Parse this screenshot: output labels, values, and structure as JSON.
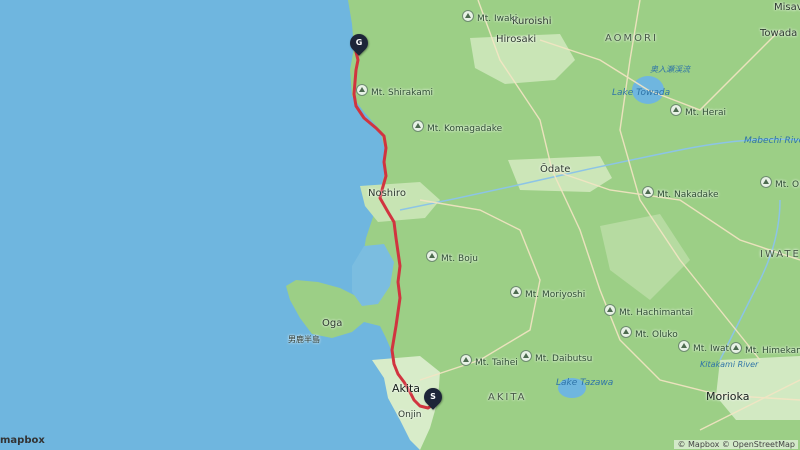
{
  "map": {
    "cities": [
      {
        "id": "misawa",
        "name": "Misav"
      },
      {
        "id": "kuroishi",
        "name": "Kuroishi"
      },
      {
        "id": "hirosaki",
        "name": "Hirosaki"
      },
      {
        "id": "towada",
        "name": "Towada"
      },
      {
        "id": "noshiro",
        "name": "Noshiro"
      },
      {
        "id": "odate",
        "name": "Ōdate"
      },
      {
        "id": "oga",
        "name": "Oga"
      },
      {
        "id": "akita",
        "name": "Akita"
      },
      {
        "id": "morioka",
        "name": "Morioka"
      }
    ],
    "cities_partial": [
      {
        "id": "oga-kanji",
        "name": "男鹿半島"
      },
      {
        "id": "akita-south",
        "name": "Onjin"
      }
    ],
    "regions": [
      {
        "id": "aomori",
        "name": "AOMORI"
      },
      {
        "id": "iwate",
        "name": "IWATE"
      },
      {
        "id": "akita-pref",
        "name": "AKITA"
      }
    ],
    "mountains": [
      {
        "id": "iwaki",
        "name": "Mt. Iwaki"
      },
      {
        "id": "shirakami",
        "name": "Mt. Shirakami"
      },
      {
        "id": "komagadake",
        "name": "Mt. Komagadake"
      },
      {
        "id": "herai",
        "name": "Mt. Herai"
      },
      {
        "id": "nakadake",
        "name": "Mt. Nakadake"
      },
      {
        "id": "orifu",
        "name": "Mt. Orifu"
      },
      {
        "id": "boju",
        "name": "Mt. Boju"
      },
      {
        "id": "moriyoshi",
        "name": "Mt. Moriyoshi"
      },
      {
        "id": "hachimantai",
        "name": "Mt. Hachimantai"
      },
      {
        "id": "oluko",
        "name": "Mt. Oluko"
      },
      {
        "id": "iwate",
        "name": "Mt. Iwate"
      },
      {
        "id": "himekami",
        "name": "Mt. Himekami"
      },
      {
        "id": "taihei",
        "name": "Mt. Taihei"
      },
      {
        "id": "daibutsu",
        "name": "Mt. Daibutsu"
      }
    ],
    "water": [
      {
        "id": "towada-lake",
        "name": "Lake Towada"
      },
      {
        "id": "towada-kanji",
        "name": "奥入瀬渓流"
      },
      {
        "id": "mabechi",
        "name": "Mabechi River"
      },
      {
        "id": "tazawa",
        "name": "Lake Tazawa"
      },
      {
        "id": "kitakami",
        "name": "Kitakami River"
      }
    ],
    "markers": {
      "start_label": "S",
      "goal_label": "G"
    },
    "attribution": "© Mapbox © OpenStreetMap",
    "logo": "mapbox",
    "colors": {
      "sea": "#6fb6df",
      "land": "#9ccf86",
      "lowland": "#cfe8be",
      "route": "#d1343f",
      "marker": "#1d2538"
    }
  }
}
